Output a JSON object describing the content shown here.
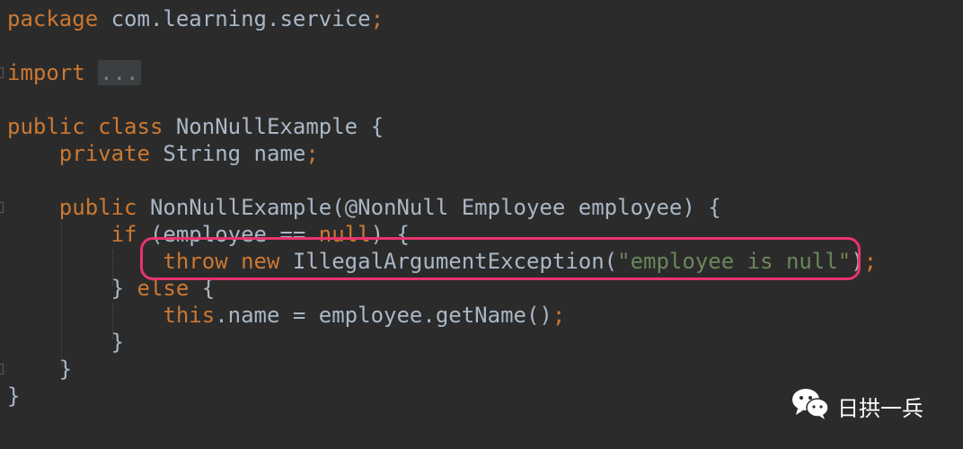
{
  "code": {
    "l1": {
      "kw": "package",
      "rest": " com.learning.service",
      "semi": ";"
    },
    "l2": {
      "kw": "import",
      "folded": "..."
    },
    "l3": {
      "kw": "public class",
      "rest": " NonNullExample {"
    },
    "l4": {
      "indent": "    ",
      "kw": "private",
      "rest": " String name",
      "semi": ";"
    },
    "l5": {
      "indent": "    ",
      "kw": "public",
      "rest": " NonNullExample(@NonNull Employee employee) {"
    },
    "l6": {
      "indent": "        ",
      "kw": "if",
      "rest1": " (employee == ",
      "kw2": "null",
      "rest2": ") {"
    },
    "l7": {
      "indent": "            ",
      "kw": "throw new",
      "rest": " IllegalArgumentException(",
      "str": "\"employee is null\"",
      "rest2": ")",
      "semi": ";"
    },
    "l8": {
      "indent": "        ",
      "rest1": "} ",
      "kw": "else",
      "rest2": " {"
    },
    "l9": {
      "indent": "            ",
      "kw": "this",
      "rest": ".name = employee.getName()",
      "semi": ";"
    },
    "l10": {
      "indent": "        ",
      "rest": "}"
    },
    "l11": {
      "indent": "    ",
      "rest": "}"
    },
    "l12": {
      "rest": "}"
    }
  },
  "watermark": {
    "text": "日拱一兵",
    "icon": "wechat-icon"
  }
}
